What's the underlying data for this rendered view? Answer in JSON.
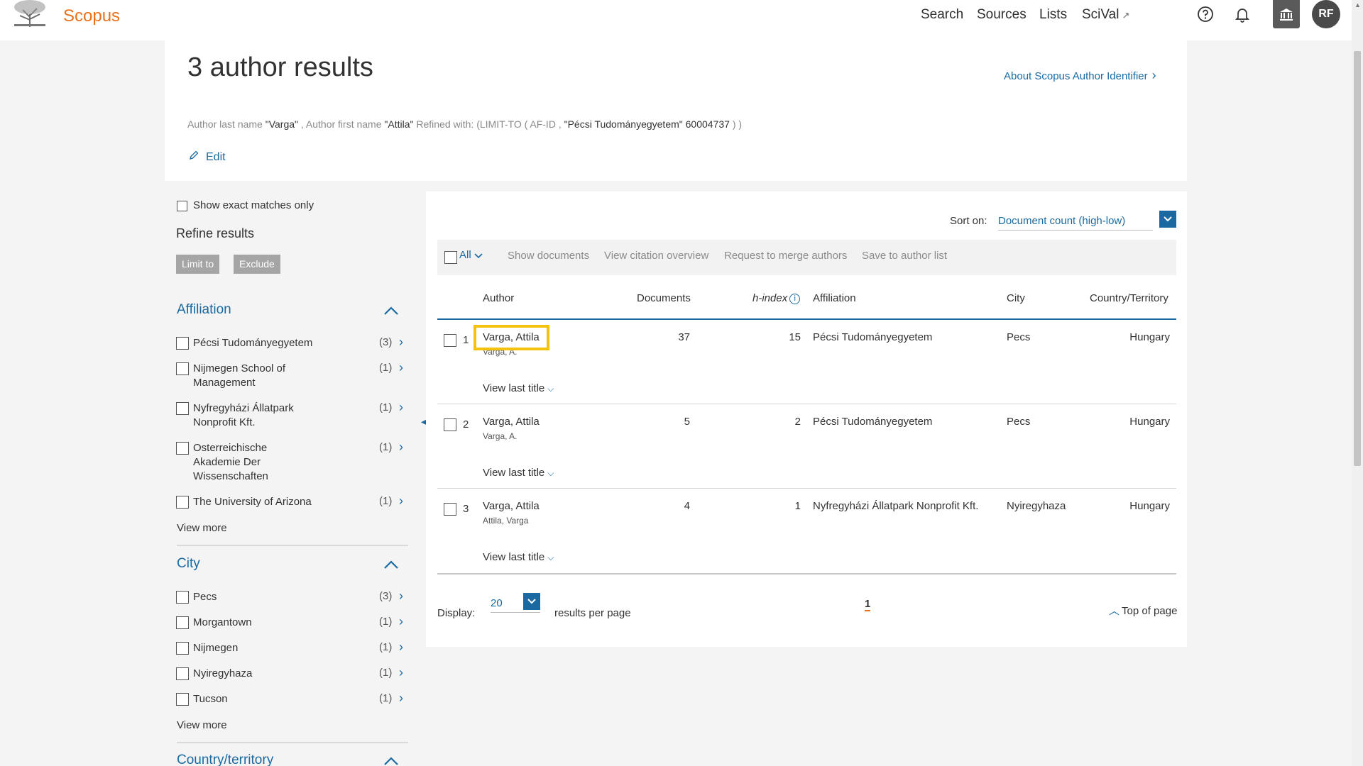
{
  "header": {
    "brand": "Scopus",
    "nav": [
      "Search",
      "Sources",
      "Lists",
      "SciVal"
    ],
    "scival_ext": "↗",
    "avatar": "RF"
  },
  "results": {
    "title": "3 author results",
    "about_link": "About Scopus Author Identifier",
    "query": {
      "lastname_label": "Author last name",
      "lastname_value": "\"Varga\"",
      "sep1": ",",
      "firstname_label": "Author first name",
      "firstname_value": "\"Attila\"",
      "refined_label": "Refined with: (LIMIT-TO ( AF-ID ,",
      "refined_value": "\"Pécsi Tudományegyetem\"   60004737",
      "refined_end": ") )"
    },
    "edit_label": "Edit"
  },
  "filters": {
    "exact_label": "Show exact matches only",
    "refine_title": "Refine results",
    "limit_label": "Limit to",
    "exclude_label": "Exclude",
    "affiliation": {
      "title": "Affiliation",
      "items": [
        {
          "label": "Pécsi Tudományegyetem",
          "count": "(3)"
        },
        {
          "label": "Nijmegen School of Management",
          "count": "(1)"
        },
        {
          "label": "Nyfregyházi Állatpark Nonprofit Kft.",
          "count": "(1)"
        },
        {
          "label": "Osterreichische Akademie Der Wissenschaften",
          "count": "(1)"
        },
        {
          "label": "The University of Arizona",
          "count": "(1)"
        }
      ],
      "view_more": "View more"
    },
    "city": {
      "title": "City",
      "items": [
        {
          "label": "Pecs",
          "count": "(3)"
        },
        {
          "label": "Morgantown",
          "count": "(1)"
        },
        {
          "label": "Nijmegen",
          "count": "(1)"
        },
        {
          "label": "Nyiregyhaza",
          "count": "(1)"
        },
        {
          "label": "Tucson",
          "count": "(1)"
        }
      ],
      "view_more": "View more"
    },
    "country": {
      "title": "Country/territory"
    }
  },
  "table": {
    "sort_label": "Sort on:",
    "sort_value": "Document count (high-low)",
    "toolbar": {
      "all": "All",
      "show_documents": "Show documents",
      "view_citation": "View citation overview",
      "merge": "Request to merge authors",
      "save": "Save to author list"
    },
    "columns": {
      "author": "Author",
      "documents": "Documents",
      "hindex": "h-index",
      "affiliation": "Affiliation",
      "city": "City",
      "country": "Country/Territory"
    },
    "rows": [
      {
        "num": "1",
        "author": "Varga, Attila",
        "variant": "Varga, A.",
        "documents": "37",
        "hindex": "15",
        "affiliation": "Pécsi Tudományegyetem",
        "city": "Pecs",
        "country": "Hungary",
        "view_last": "View last title"
      },
      {
        "num": "2",
        "author": "Varga, Attila",
        "variant": "Varga, A.",
        "documents": "5",
        "hindex": "2",
        "affiliation": "Pécsi Tudományegyetem",
        "city": "Pecs",
        "country": "Hungary",
        "view_last": "View last title"
      },
      {
        "num": "3",
        "author": "Varga, Attila",
        "variant": "Attila, Varga",
        "documents": "4",
        "hindex": "1",
        "affiliation": "Nyfregyházi Állatpark Nonprofit Kft.",
        "city": "Nyiregyhaza",
        "country": "Hungary",
        "view_last": "View last title"
      }
    ],
    "display_label": "Display:",
    "display_value": "20",
    "per_page": "results per page",
    "page": "1",
    "top_of_page": "Top of page"
  },
  "colors": {
    "brand": "#e9711c",
    "link": "#1a6aa1",
    "highlight": "#f4c20d"
  }
}
